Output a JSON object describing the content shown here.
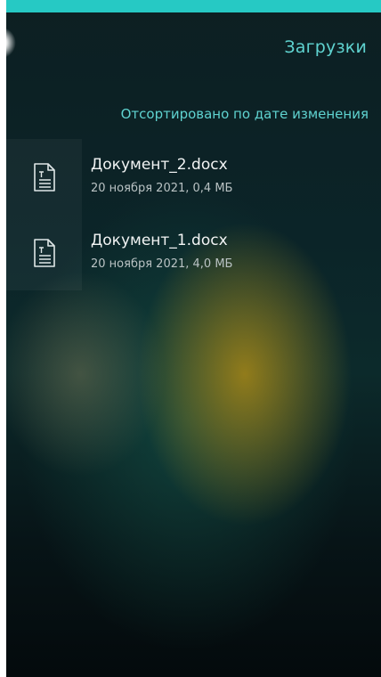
{
  "header": {
    "title": "Загрузки"
  },
  "sort": {
    "label": "Отсортировано по дате изменения"
  },
  "files": [
    {
      "name": "Документ_2.docx",
      "meta": "20 ноября 2021, 0,4 МБ",
      "icon": "document-text-icon"
    },
    {
      "name": "Документ_1.docx",
      "meta": "20 ноября 2021, 4,0 МБ",
      "icon": "document-text-icon"
    }
  ],
  "colors": {
    "accent": "#26c9c4",
    "accent_text": "#5fd3d0",
    "primary_text": "#f2f4f4",
    "secondary_text": "#b9c2c3"
  }
}
